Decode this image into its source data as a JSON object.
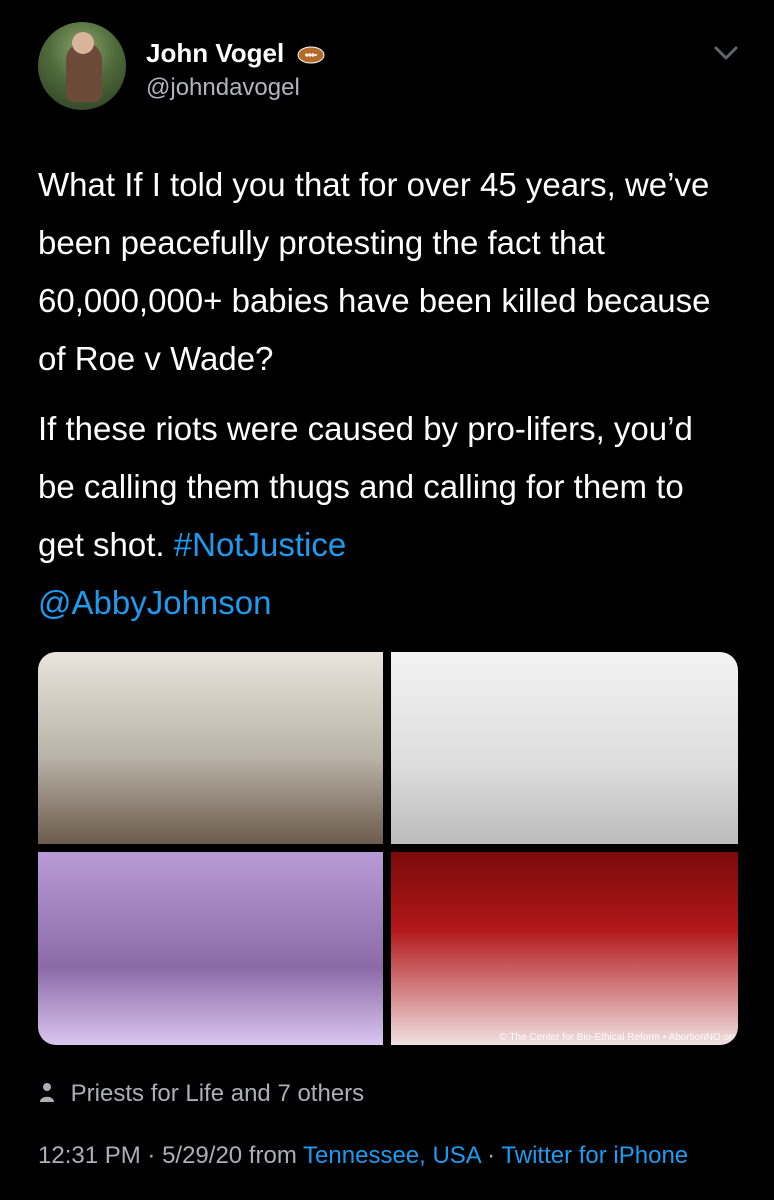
{
  "user": {
    "name": "John Vogel",
    "handle": "@johndavogel"
  },
  "tweet": {
    "paragraph1": "What If I told you that for over 45 years, we’ve been peacefully protesting the fact that 60,000,000+ babies have been killed because of Roe v Wade?",
    "paragraph2_text": "If these riots were caused by pro-lifers, you’d be calling them thugs and calling for them to get shot.",
    "hashtag": "#NotJustice",
    "mention": "@AbbyJohnson"
  },
  "media": {
    "watermark": "© The Center for Bio-Ethical Reform • AbortionNO.org"
  },
  "engagement": {
    "text": "Priests for Life and 7 others"
  },
  "meta": {
    "time": "12:31 PM",
    "separator1": " · ",
    "date": "5/29/20",
    "from": " from ",
    "location": "Tennessee, USA",
    "separator2": " · ",
    "source": "Twitter for iPhone"
  },
  "colors": {
    "accent": "#1d9bf0",
    "muted": "#aab0b6",
    "background": "#000000"
  },
  "icons": {
    "name_badge": "football-icon",
    "menu": "chevron-down-icon",
    "engagement": "person-icon"
  }
}
